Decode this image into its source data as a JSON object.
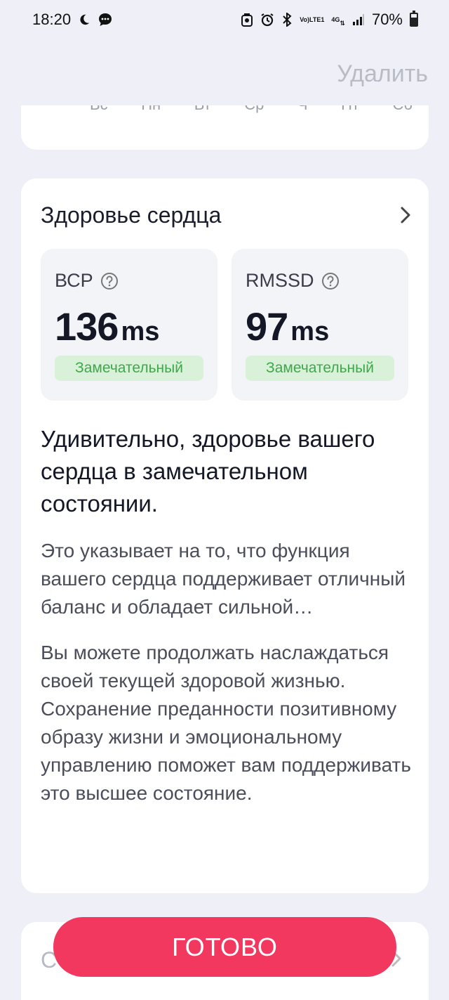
{
  "status_bar": {
    "time": "18:20",
    "battery": "70%",
    "network_top": "4G",
    "volte_top": "Vo)",
    "volte_bottom": "LTE1",
    "icons": [
      "moon-icon",
      "chat-icon",
      "app-icon",
      "alarm-icon",
      "bluetooth-icon",
      "signal-icon",
      "battery-icon"
    ]
  },
  "header": {
    "delete_label": "Удалить"
  },
  "week": {
    "days": [
      "Вс",
      "Пн",
      "Вт",
      "Ср",
      "Ч",
      "Пт",
      "Сб"
    ]
  },
  "heart_card": {
    "title": "Здоровье сердца",
    "metrics": [
      {
        "label": "ВСР",
        "value": "136",
        "unit": "ms",
        "badge": "Замечательный"
      },
      {
        "label": "RMSSD",
        "value": "97",
        "unit": "ms",
        "badge": "Замечательный"
      }
    ],
    "lead": "Удивительно, здоровье вашего сердца в замечательном состоянии.",
    "paragraph1": "Это указывает на то, что функция вашего сердца поддерживает отличный баланс и обладает сильной устойчивостью.",
    "paragraph2": "Вы можете продолжать наслаждаться своей текущей здоровой жизнью. Сохранение преданности позитивному образу жизни и эмоциональному управлению поможет вам поддерживать это высшее состояние."
  },
  "bottom_card": {
    "partial_text": "С"
  },
  "done_button": {
    "label": "ГОТОВО"
  },
  "colors": {
    "background": "#eeeff7",
    "accent": "#f2385f",
    "badge_bg": "#d9f1d9",
    "badge_text": "#3ea84a"
  }
}
